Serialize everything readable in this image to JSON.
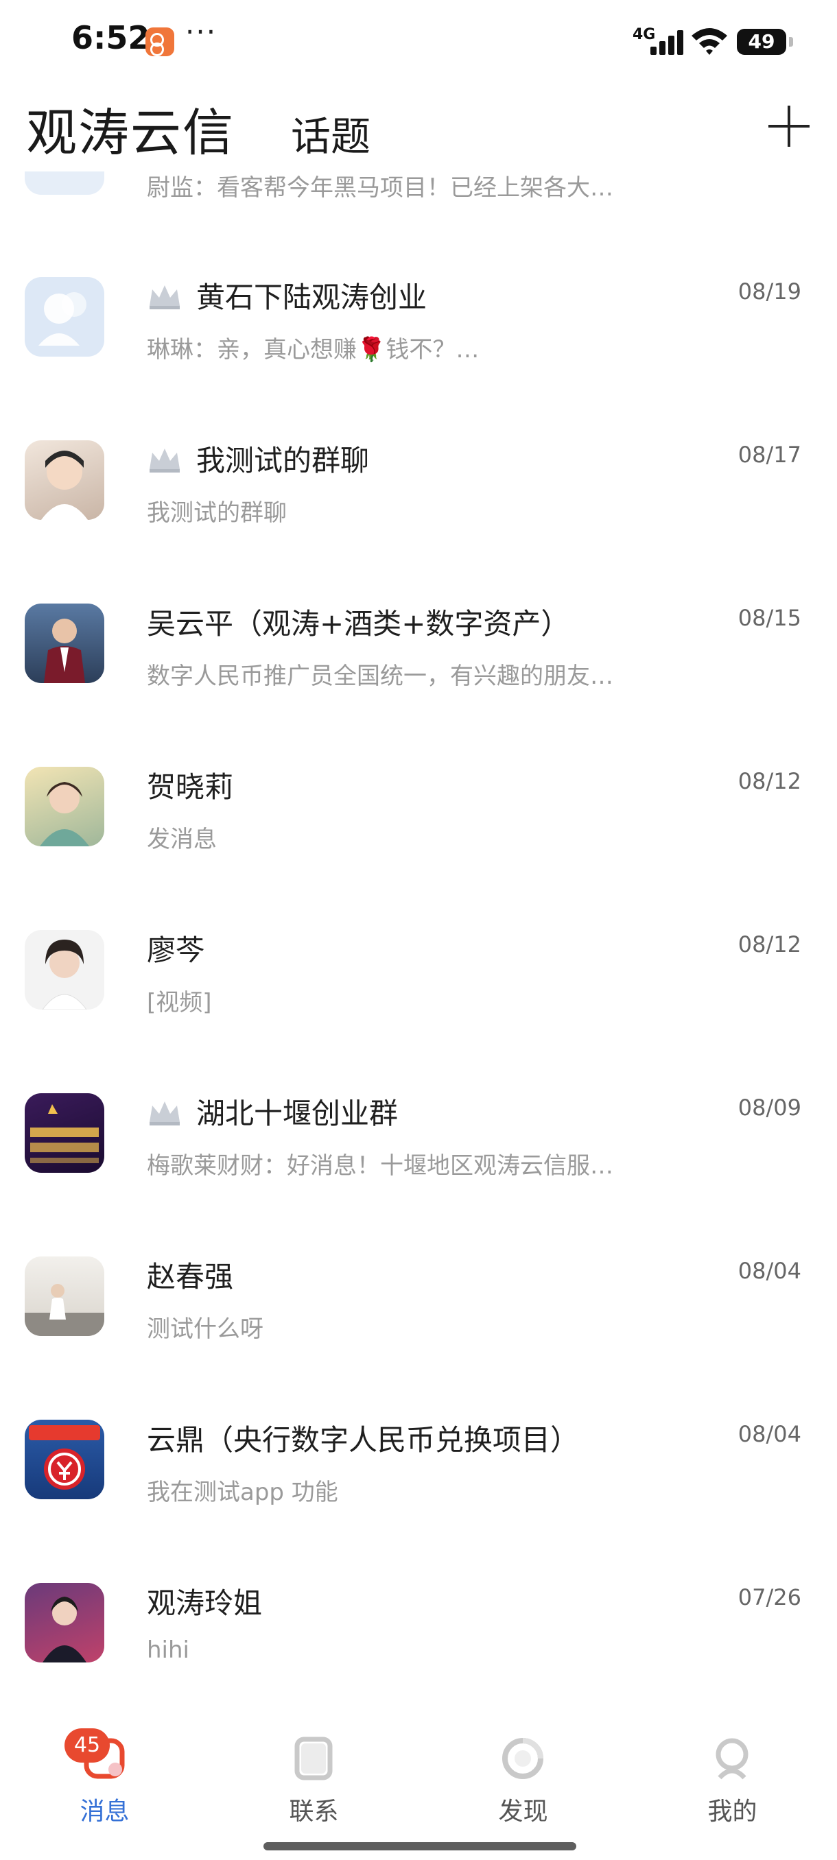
{
  "status_bar": {
    "time": "6:52",
    "dots": "···",
    "network": "4G",
    "battery": "49"
  },
  "header": {
    "title": "观涛云信",
    "tab": "话题"
  },
  "conversations": [
    {
      "name": "",
      "date": "",
      "preview": "尉监：看客帮今年黑马项目！已经上架各大…",
      "crown": false
    },
    {
      "name": "黄石下陆观涛创业",
      "date": "08/19",
      "preview": "琳琳：亲，真心想赚🌹钱不？…",
      "crown": true
    },
    {
      "name": "我测试的群聊",
      "date": "08/17",
      "preview": "我测试的群聊",
      "crown": true
    },
    {
      "name": "吴云平（观涛+酒类+数字资产）",
      "date": "08/15",
      "preview": "数字人民币推广员全国统一，有兴趣的朋友…",
      "crown": false
    },
    {
      "name": "贺晓莉",
      "date": "08/12",
      "preview": "发消息",
      "crown": false
    },
    {
      "name": "廖芩",
      "date": "08/12",
      "preview": "[视频]",
      "crown": false
    },
    {
      "name": "湖北十堰创业群",
      "date": "08/09",
      "preview": "梅歌莱财财：好消息！十堰地区观涛云信服…",
      "crown": true
    },
    {
      "name": "赵春强",
      "date": "08/04",
      "preview": "测试什么呀",
      "crown": false
    },
    {
      "name": "云鼎（央行数字人民币兑换项目）",
      "date": "08/04",
      "preview": "我在测试app 功能",
      "crown": false
    },
    {
      "name": "观涛玲姐",
      "date": "07/26",
      "preview": "hihi",
      "crown": false
    }
  ],
  "tabbar": {
    "badge": "45",
    "tabs": [
      {
        "label": "消息",
        "icon": "message-icon"
      },
      {
        "label": "联系",
        "icon": "contacts-icon"
      },
      {
        "label": "发现",
        "icon": "discover-icon"
      },
      {
        "label": "我的",
        "icon": "profile-icon"
      }
    ]
  },
  "colors": {
    "accent": "#3470d6",
    "badge": "#e8492f",
    "text": "#1f1f1f",
    "secondary": "#9a9a9a"
  }
}
